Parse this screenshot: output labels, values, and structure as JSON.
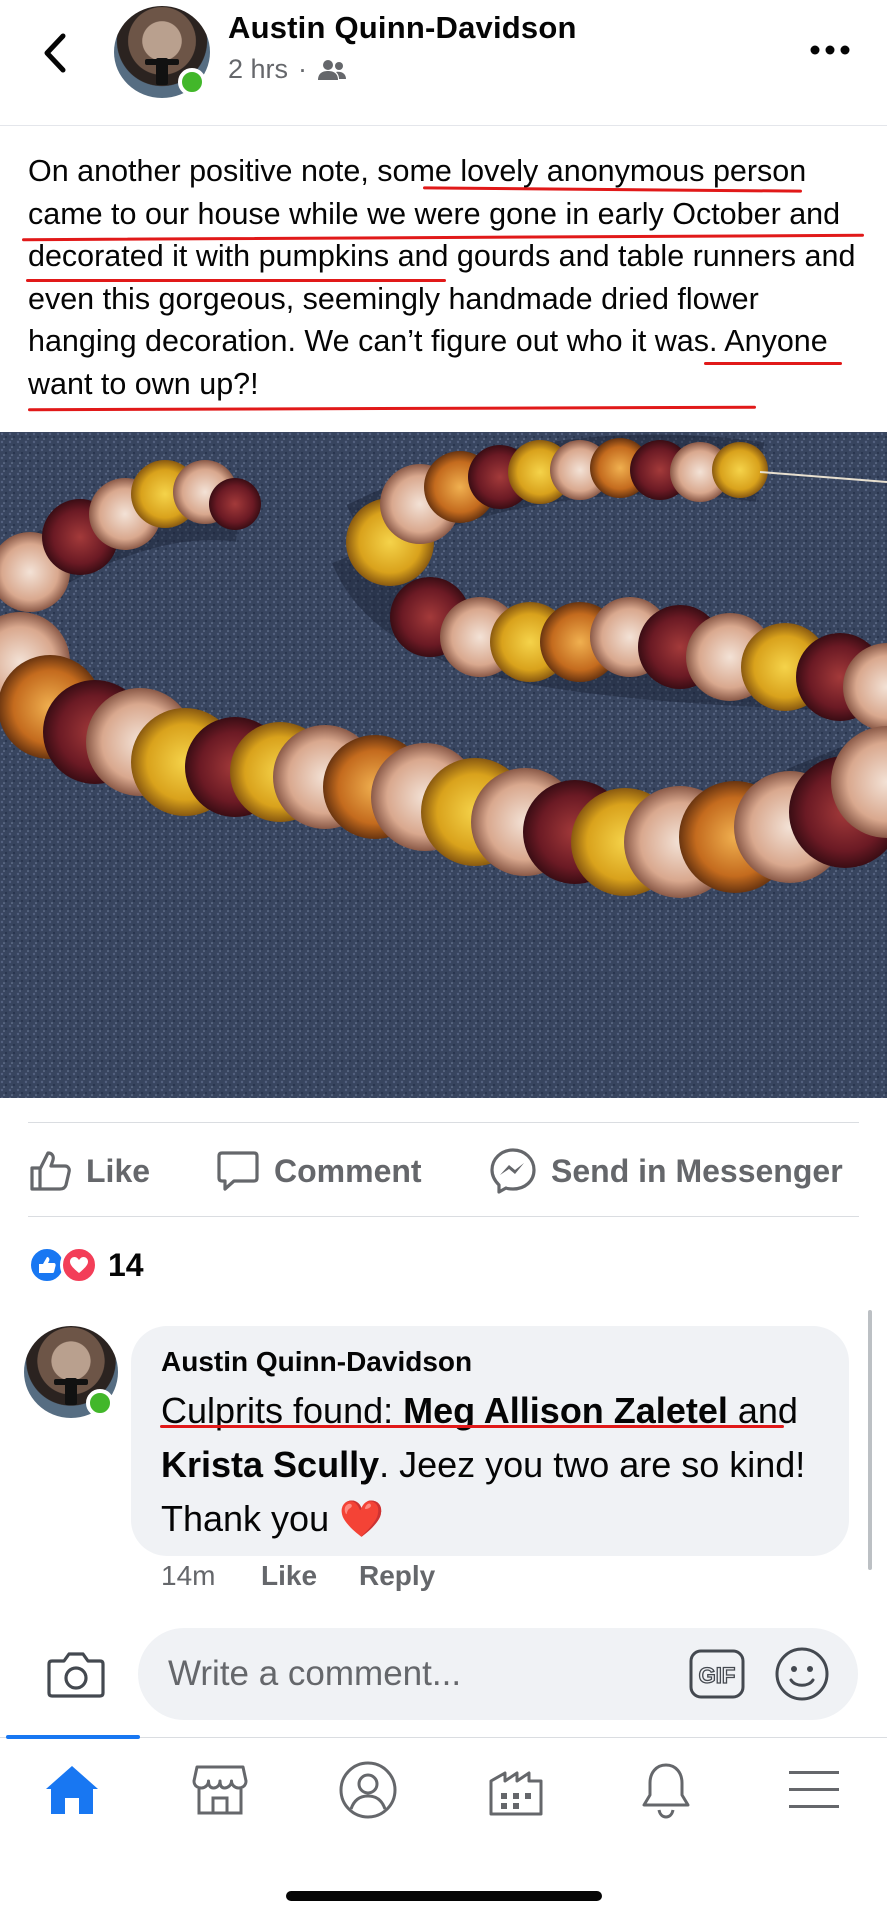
{
  "header": {
    "author": "Austin Quinn-Davidson",
    "timestamp": "2 hrs",
    "separator": "·",
    "audience_icon": "friends-icon",
    "back_icon": "chevron-left-icon",
    "more_icon": "more-horizontal-icon"
  },
  "post": {
    "text": "On another positive note, some lovely anonymous person came to our house while we were gone in early October and decorated it with pumpkins and gourds and table runners and even this gorgeous, seemingly handmade dried flower hanging decoration. We can’t figure out who it was. Anyone want to own up?!",
    "photo_subject": "dried-flower-garland-photo"
  },
  "actions": {
    "like": "Like",
    "comment": "Comment",
    "send": "Send in Messenger"
  },
  "reactions": {
    "count": "14",
    "types": [
      "like",
      "love"
    ]
  },
  "comment": {
    "author": "Austin Quinn-Davidson",
    "text_prefix": "Culprits found: ",
    "mention1": "Meg Allison Zaletel",
    "text_mid": " and ",
    "mention2": "Krista Scully",
    "text_suffix": ". Jeez you two are so kind! Thank you ",
    "emoji": "❤️",
    "time": "14m",
    "like": "Like",
    "reply": "Reply"
  },
  "composer": {
    "placeholder": "Write a comment...",
    "gif": "GIF"
  },
  "nav": [
    "home-icon",
    "marketplace-icon",
    "profile-icon",
    "pages-icon",
    "notifications-icon",
    "menu-icon"
  ],
  "colors": {
    "brand_blue": "#1877f2",
    "online_green": "#42b72a",
    "annotation_red": "#e11919",
    "secondary_text": "#65676b",
    "bubble_bg": "#f0f2f5"
  }
}
